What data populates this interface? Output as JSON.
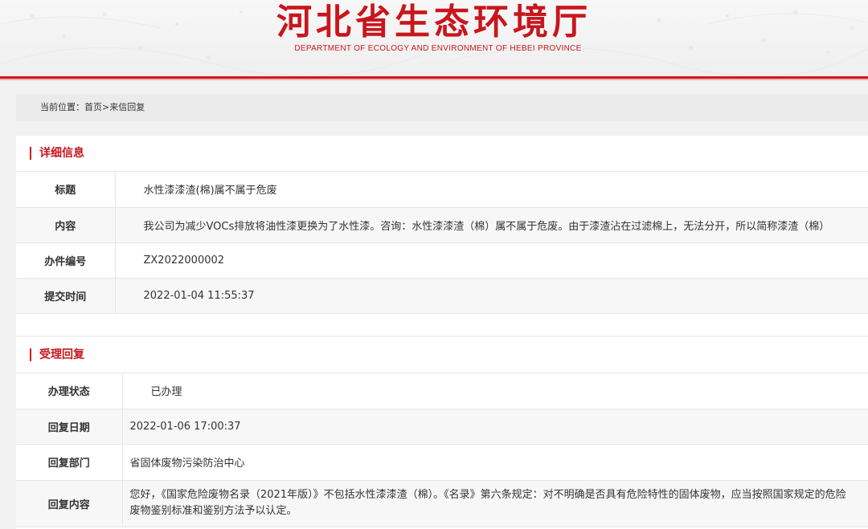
{
  "header": {
    "title": "河北省生态环境厅",
    "subtitle": "DEPARTMENT OF ECOLOGY AND ENVIRONMENT OF HEBEI PROVINCE"
  },
  "breadcrumb": {
    "prefix": "当前位置：",
    "home": "首页",
    "separator": ">",
    "current": "来信回复"
  },
  "detail": {
    "heading": "详细信息",
    "rows": [
      {
        "label": "标题",
        "value": "水性漆漆渣(棉)属不属于危废"
      },
      {
        "label": "内容",
        "value": "我公司为减少VOCs排放将油性漆更换为了水性漆。咨询：水性漆漆渣（棉）属不属于危废。由于漆渣沾在过滤棉上，无法分开，所以简称漆渣（棉）"
      },
      {
        "label": "办件编号",
        "value": "ZX2022000002"
      },
      {
        "label": "提交时间",
        "value": "2022-01-04 11:55:37"
      }
    ]
  },
  "reply": {
    "heading": "受理回复",
    "rows": [
      {
        "label": "办理状态",
        "value": "已办理"
      },
      {
        "label": "回复日期",
        "value": "2022-01-06 17:00:37"
      },
      {
        "label": "回复部门",
        "value": "省固体废物污染防治中心"
      },
      {
        "label": "回复内容",
        "value": "您好，《国家危险废物名录（2021年版）》不包括水性漆漆渣（棉）。《名录》第六条规定：对不明确是否具有危险特性的固体废物，应当按照国家规定的危险废物鉴别标准和鉴别方法予以认定。"
      }
    ]
  },
  "colors": {
    "brand_red": "#c8161d",
    "status_green": "#2b8a1e"
  }
}
